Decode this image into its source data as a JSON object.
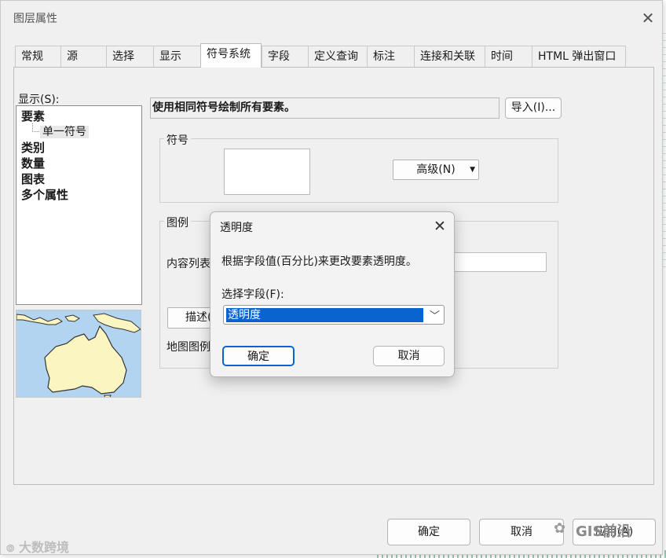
{
  "window": {
    "title": "图层属性"
  },
  "tabs": [
    "常规",
    "源",
    "选择",
    "显示",
    "符号系统",
    "字段",
    "定义查询",
    "标注",
    "连接和关联",
    "时间",
    "HTML 弹出窗口"
  ],
  "active_tab": "符号系统",
  "left": {
    "show_label": "显示(S):",
    "tree": {
      "features": "要素",
      "single_symbol": "单一符号",
      "categories": "类别",
      "quantities": "数量",
      "charts": "图表",
      "multiple_attributes": "多个属性"
    }
  },
  "main": {
    "header": "使用相同符号绘制所有要素。",
    "import_button": "导入(I)...",
    "symbol_group": "符号",
    "advanced_button": "高级(N)",
    "legend_group": "图例",
    "toc_label": "内容列表",
    "description_button": "描述(",
    "map_legend_label": "地图图例"
  },
  "dialog": {
    "title": "透明度",
    "message": "根据字段值(百分比)来更改要素透明度。",
    "field_label": "选择字段(F):",
    "field_value": "透明度",
    "ok": "确定",
    "cancel": "取消"
  },
  "footer": {
    "ok": "确定",
    "cancel": "取消",
    "apply": "应用(A)"
  },
  "watermarks": {
    "left": "大数跨境",
    "right": "GIS前沿"
  },
  "colors": {
    "selection": "#0a64d0",
    "map_water": "#b3d4f0",
    "map_land": "#fbf5c2"
  }
}
